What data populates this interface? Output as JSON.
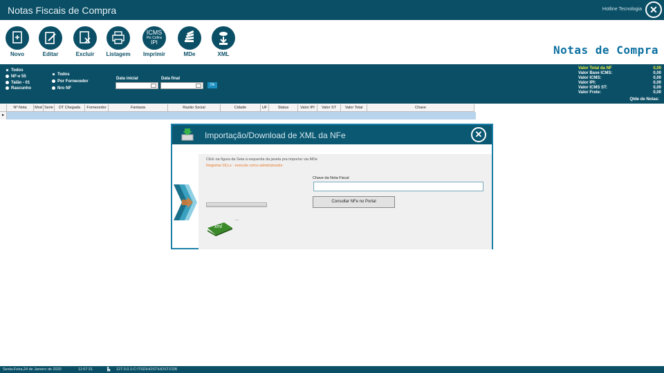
{
  "window": {
    "title": "Notas Fiscais de Compra",
    "hotline": "Hotline Tecnologia",
    "close_glyph": "✕"
  },
  "brand": "Notas de Compra",
  "toolbar": {
    "buttons": [
      {
        "label": "Novo",
        "icon": "new-document-icon"
      },
      {
        "label": "Editar",
        "icon": "edit-icon"
      },
      {
        "label": "Excluir",
        "icon": "delete-icon"
      },
      {
        "label": "Listagem",
        "icon": "printer-icon"
      },
      {
        "label": "Imprimir",
        "icon": "tax-icon",
        "icon_text": [
          "ICMS",
          "Pis Cofins",
          "IPI"
        ]
      },
      {
        "label": "MDe",
        "icon": "stack-icon"
      },
      {
        "label": "XML",
        "icon": "download-icon"
      }
    ]
  },
  "filters": {
    "type_options": [
      "Todos",
      "NF-e 55",
      "Talão - 01",
      "Rascunho"
    ],
    "supplier_options": [
      "Todos",
      "Por Fornecedor",
      "Nro NF"
    ],
    "date_start_label": "Data inicial",
    "date_end_label": "Data final",
    "ok_label": "Ok"
  },
  "totals": {
    "rows": [
      {
        "label": "Valor Total da NF",
        "value": "0,00"
      },
      {
        "label": "Valor Base ICMS:",
        "value": "0,00"
      },
      {
        "label": "Valor ICMS:",
        "value": "0,00"
      },
      {
        "label": "Valor IPI:",
        "value": "0,00"
      },
      {
        "label": "Valor ICMS ST:",
        "value": "0,00"
      },
      {
        "label": "Valor Frete:",
        "value": "0,00"
      }
    ],
    "qtd_label": "Qtde de Notas:"
  },
  "grid": {
    "columns": [
      "Nº Nota",
      "Mod",
      "Serie",
      "DT Chegada",
      "Fornecedor",
      "Fantasia",
      "Razão Social",
      "Cidade",
      "UF",
      "Status",
      "Valor IPI",
      "Valor ST",
      "Valor Total",
      "Chave"
    ],
    "indicator": "▸"
  },
  "dialog": {
    "title": "Importação/Download de XML da NFe",
    "close_glyph": "✕",
    "hint": "Click na figura da Seta à esquerda da janela pra importar via MDe",
    "register": "Registrar DLLs - execute como administrador",
    "key_label": "Chave da Nota Fiscal",
    "key_value": "",
    "consult_button": "Consultar NFe no Portal",
    "ellipsis": "...",
    "xml_text": "xml"
  },
  "statusbar": {
    "date": "Sexta-Feira,24 de Janeiro de 2020",
    "time": "11:57:31",
    "db": "127.0.0.1:C:\\TSD\\HOST\\HOST.FDB"
  },
  "colors": {
    "primary": "#0a4f66",
    "brand": "#0a6fa0",
    "accent_orange": "#e87a2a",
    "highlight_yellow": "#f0f040"
  }
}
